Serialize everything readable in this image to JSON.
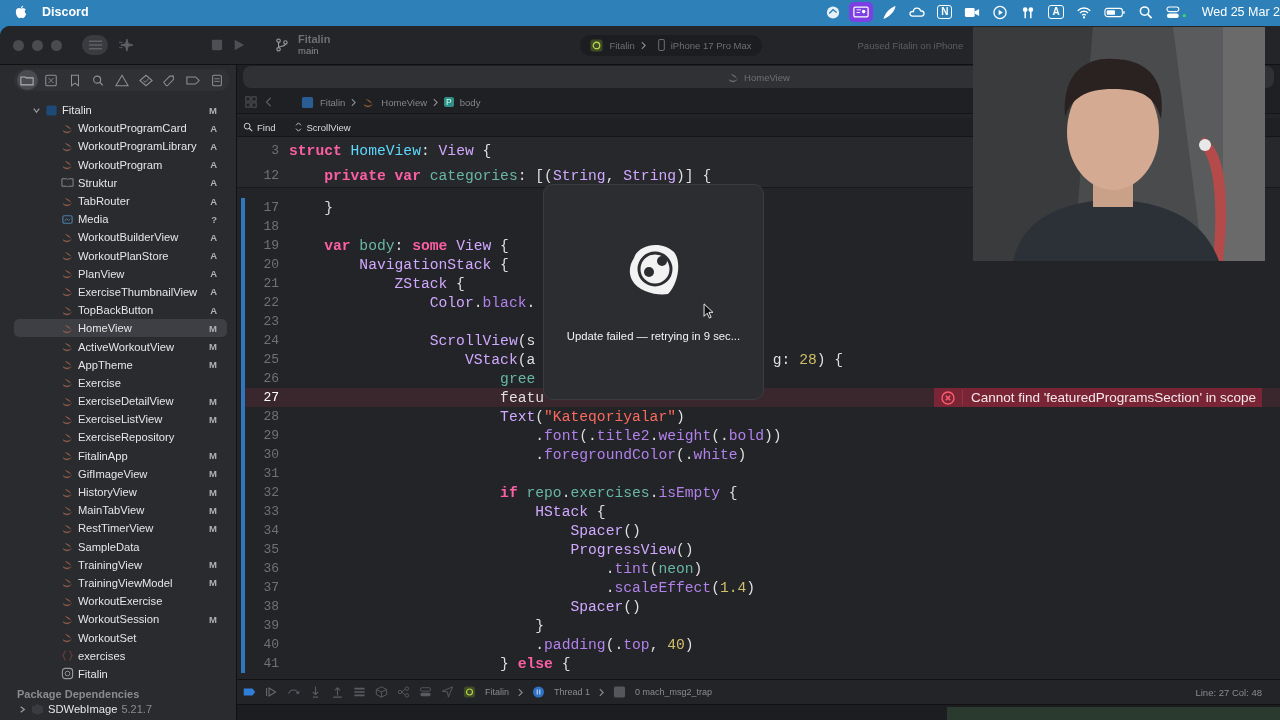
{
  "menu_bar": {
    "app_name": "Discord",
    "extras": [
      {
        "kind": "sync",
        "active": false
      },
      {
        "kind": "screen",
        "active": true
      },
      {
        "kind": "feather",
        "active": false
      },
      {
        "kind": "cloud",
        "active": false
      },
      {
        "kind": "letter",
        "glyph": "N",
        "active": false
      },
      {
        "kind": "camera",
        "active": false
      },
      {
        "kind": "play",
        "active": false
      },
      {
        "kind": "earbuds",
        "active": false
      },
      {
        "kind": "letter",
        "glyph": "A",
        "active": false
      },
      {
        "kind": "wifi",
        "active": false
      },
      {
        "kind": "battery",
        "active": false
      },
      {
        "kind": "search",
        "active": false
      },
      {
        "kind": "control",
        "active": false
      }
    ],
    "clock": "Wed 25 Mar 2"
  },
  "toolbar": {
    "project": "Fitalin",
    "branch": "main",
    "scheme": "Fitalin",
    "destination": "iPhone 17 Pro Max",
    "status": "Paused Fitalin on iPhone"
  },
  "navigator_tabs": [
    {
      "selected": true
    },
    {
      "selected": false
    },
    {
      "selected": false
    },
    {
      "selected": false
    },
    {
      "selected": false
    },
    {
      "selected": false
    },
    {
      "selected": false
    },
    {
      "selected": false
    },
    {
      "selected": false
    }
  ],
  "sidebar": {
    "project": {
      "name": "Fitalin",
      "status": "M",
      "kind": "project",
      "expanded": true,
      "selected": false,
      "children": [
        {
          "name": "WorkoutProgramCard",
          "status": "A",
          "kind": "swift",
          "selected": false
        },
        {
          "name": "WorkoutProgramLibrary",
          "status": "A",
          "kind": "swift",
          "selected": false
        },
        {
          "name": "WorkoutProgram",
          "status": "A",
          "kind": "swift",
          "selected": false
        },
        {
          "name": "Struktur",
          "status": "A",
          "kind": "book",
          "selected": false
        },
        {
          "name": "TabRouter",
          "status": "A",
          "kind": "swift",
          "selected": false
        },
        {
          "name": "Media",
          "status": "?",
          "kind": "assets",
          "selected": false
        },
        {
          "name": "WorkoutBuilderView",
          "status": "A",
          "kind": "swift",
          "selected": false
        },
        {
          "name": "WorkoutPlanStore",
          "status": "A",
          "kind": "swift",
          "selected": false
        },
        {
          "name": "PlanView",
          "status": "A",
          "kind": "swift",
          "selected": false
        },
        {
          "name": "ExerciseThumbnailView",
          "status": "A",
          "kind": "swift",
          "selected": false
        },
        {
          "name": "TopBackButton",
          "status": "A",
          "kind": "swift",
          "selected": false
        },
        {
          "name": "HomeView",
          "status": "M",
          "kind": "swift",
          "selected": true
        },
        {
          "name": "ActiveWorkoutView",
          "status": "M",
          "kind": "swift",
          "selected": false
        },
        {
          "name": "AppTheme",
          "status": "M",
          "kind": "swift",
          "selected": false
        },
        {
          "name": "Exercise",
          "kind": "swift",
          "selected": false
        },
        {
          "name": "ExerciseDetailView",
          "status": "M",
          "kind": "swift",
          "selected": false
        },
        {
          "name": "ExerciseListView",
          "status": "M",
          "kind": "swift",
          "selected": false
        },
        {
          "name": "ExerciseRepository",
          "kind": "swift",
          "selected": false
        },
        {
          "name": "FitalinApp",
          "status": "M",
          "kind": "swift",
          "selected": false
        },
        {
          "name": "GifImageView",
          "status": "M",
          "kind": "swift",
          "selected": false
        },
        {
          "name": "HistoryView",
          "status": "M",
          "kind": "swift",
          "selected": false
        },
        {
          "name": "MainTabView",
          "status": "M",
          "kind": "swift",
          "selected": false
        },
        {
          "name": "RestTimerView",
          "status": "M",
          "kind": "swift",
          "selected": false
        },
        {
          "name": "SampleData",
          "kind": "swift",
          "selected": false
        },
        {
          "name": "TrainingView",
          "status": "M",
          "kind": "swift",
          "selected": false
        },
        {
          "name": "TrainingViewModel",
          "status": "M",
          "kind": "swift",
          "selected": false
        },
        {
          "name": "WorkoutExercise",
          "kind": "swift",
          "selected": false
        },
        {
          "name": "WorkoutSession",
          "status": "M",
          "kind": "swift",
          "selected": false
        },
        {
          "name": "WorkoutSet",
          "kind": "swift",
          "selected": false
        },
        {
          "name": "exercises",
          "kind": "json",
          "selected": false
        },
        {
          "name": "Fitalin",
          "kind": "app",
          "selected": false
        }
      ]
    },
    "packages": {
      "title": "Package Dependencies",
      "items": [
        {
          "name": "SDWebImage",
          "version": "5.21.7",
          "expanded": false
        }
      ]
    }
  },
  "editor": {
    "tab": "HomeView",
    "breadcrumb": {
      "project": "Fitalin",
      "file": "HomeView",
      "symbol_badge": "P",
      "symbol": "body"
    },
    "find": {
      "label": "Find",
      "scope": "ScrollView"
    },
    "sticky_lines": [
      {
        "number": "3",
        "tokens": [
          {
            "kind": "kw",
            "text": "struct"
          },
          {
            "kind": "decl",
            "text": " HomeView"
          },
          {
            "kind": "plain",
            "text": ": "
          },
          {
            "kind": "type",
            "text": "View"
          },
          {
            "kind": "plain",
            "text": " {"
          }
        ]
      },
      {
        "number": "12",
        "tokens": [
          {
            "kind": "kw",
            "text": "    private var"
          },
          {
            "kind": "var",
            "text": " categories"
          },
          {
            "kind": "plain",
            "text": ": [("
          },
          {
            "kind": "type",
            "text": "String"
          },
          {
            "kind": "plain",
            "text": ", "
          },
          {
            "kind": "type",
            "text": "String"
          },
          {
            "kind": "plain",
            "text": ")] {"
          }
        ]
      }
    ],
    "lines": [
      {
        "number": "17",
        "current": false,
        "tokens": [
          {
            "kind": "plain",
            "text": "    }"
          }
        ]
      },
      {
        "number": "18",
        "current": false
      },
      {
        "number": "19",
        "current": false,
        "tokens": [
          {
            "kind": "kw",
            "text": "    var"
          },
          {
            "kind": "var",
            "text": " body"
          },
          {
            "kind": "plain",
            "text": ": "
          },
          {
            "kind": "kw",
            "text": "some"
          },
          {
            "kind": "type",
            "text": " View"
          },
          {
            "kind": "plain",
            "text": " {"
          }
        ]
      },
      {
        "number": "20",
        "current": false,
        "tokens": [
          {
            "kind": "type",
            "text": "        NavigationStack"
          },
          {
            "kind": "plain",
            "text": " {"
          }
        ]
      },
      {
        "number": "21",
        "current": false,
        "tokens": [
          {
            "kind": "type",
            "text": "            ZStack"
          },
          {
            "kind": "plain",
            "text": " {"
          }
        ]
      },
      {
        "number": "22",
        "current": false,
        "tokens": [
          {
            "kind": "type",
            "text": "                Color"
          },
          {
            "kind": "plain",
            "text": "."
          },
          {
            "kind": "member",
            "text": "black"
          },
          {
            "kind": "plain",
            "text": "."
          }
        ]
      },
      {
        "number": "23",
        "current": false
      },
      {
        "number": "24",
        "current": false,
        "tokens": [
          {
            "kind": "type",
            "text": "                ScrollView"
          },
          {
            "kind": "plain",
            "text": "(s"
          }
        ]
      },
      {
        "number": "25",
        "current": false,
        "tokens": [
          {
            "kind": "type",
            "text": "                    VStack"
          },
          {
            "kind": "plain",
            "text": "(a                           g: "
          },
          {
            "kind": "num",
            "text": "28"
          },
          {
            "kind": "plain",
            "text": ") {"
          }
        ]
      },
      {
        "number": "26",
        "current": false,
        "tokens": [
          {
            "kind": "var",
            "text": "                        gree"
          }
        ]
      },
      {
        "number": "27",
        "current": true,
        "tokens": [
          {
            "kind": "plain",
            "text": "                        featu"
          }
        ],
        "error": "Cannot find 'featuredProgramsSection' in scope"
      },
      {
        "number": "28",
        "current": false,
        "tokens": [
          {
            "kind": "type",
            "text": "                        Text"
          },
          {
            "kind": "plain",
            "text": "("
          },
          {
            "kind": "str",
            "text": "\"Kateqoriyalar\""
          },
          {
            "kind": "plain",
            "text": ")"
          }
        ]
      },
      {
        "number": "29",
        "current": false,
        "tokens": [
          {
            "kind": "plain",
            "text": "                            ."
          },
          {
            "kind": "member",
            "text": "font"
          },
          {
            "kind": "plain",
            "text": "(."
          },
          {
            "kind": "member",
            "text": "title2"
          },
          {
            "kind": "plain",
            "text": "."
          },
          {
            "kind": "member",
            "text": "weight"
          },
          {
            "kind": "plain",
            "text": "(."
          },
          {
            "kind": "member",
            "text": "bold"
          },
          {
            "kind": "plain",
            "text": "))"
          }
        ]
      },
      {
        "number": "30",
        "current": false,
        "tokens": [
          {
            "kind": "plain",
            "text": "                            ."
          },
          {
            "kind": "member",
            "text": "foregroundColor"
          },
          {
            "kind": "plain",
            "text": "(."
          },
          {
            "kind": "member",
            "text": "white"
          },
          {
            "kind": "plain",
            "text": ")"
          }
        ]
      },
      {
        "number": "31",
        "current": false
      },
      {
        "number": "32",
        "current": false,
        "tokens": [
          {
            "kind": "kw",
            "text": "                        if"
          },
          {
            "kind": "var",
            "text": " repo"
          },
          {
            "kind": "plain",
            "text": "."
          },
          {
            "kind": "var",
            "text": "exercises"
          },
          {
            "kind": "plain",
            "text": "."
          },
          {
            "kind": "member",
            "text": "isEmpty"
          },
          {
            "kind": "plain",
            "text": " {"
          }
        ]
      },
      {
        "number": "33",
        "current": false,
        "tokens": [
          {
            "kind": "type",
            "text": "                            HStack"
          },
          {
            "kind": "plain",
            "text": " {"
          }
        ]
      },
      {
        "number": "34",
        "current": false,
        "tokens": [
          {
            "kind": "type",
            "text": "                                Spacer"
          },
          {
            "kind": "plain",
            "text": "()"
          }
        ]
      },
      {
        "number": "35",
        "current": false,
        "tokens": [
          {
            "kind": "type",
            "text": "                                ProgressView"
          },
          {
            "kind": "plain",
            "text": "()"
          }
        ]
      },
      {
        "number": "36",
        "current": false,
        "tokens": [
          {
            "kind": "plain",
            "text": "                                    ."
          },
          {
            "kind": "member",
            "text": "tint"
          },
          {
            "kind": "plain",
            "text": "("
          },
          {
            "kind": "var",
            "text": "neon"
          },
          {
            "kind": "plain",
            "text": ")"
          }
        ]
      },
      {
        "number": "37",
        "current": false,
        "tokens": [
          {
            "kind": "plain",
            "text": "                                    ."
          },
          {
            "kind": "member",
            "text": "scaleEffect"
          },
          {
            "kind": "plain",
            "text": "("
          },
          {
            "kind": "num",
            "text": "1.4"
          },
          {
            "kind": "plain",
            "text": ")"
          }
        ]
      },
      {
        "number": "38",
        "current": false,
        "tokens": [
          {
            "kind": "type",
            "text": "                                Spacer"
          },
          {
            "kind": "plain",
            "text": "()"
          }
        ]
      },
      {
        "number": "39",
        "current": false,
        "tokens": [
          {
            "kind": "plain",
            "text": "                            }"
          }
        ]
      },
      {
        "number": "40",
        "current": false,
        "tokens": [
          {
            "kind": "plain",
            "text": "                            ."
          },
          {
            "kind": "member",
            "text": "padding"
          },
          {
            "kind": "plain",
            "text": "(."
          },
          {
            "kind": "member",
            "text": "top"
          },
          {
            "kind": "plain",
            "text": ", "
          },
          {
            "kind": "num",
            "text": "40"
          },
          {
            "kind": "plain",
            "text": ")"
          }
        ]
      },
      {
        "number": "41",
        "current": false,
        "tokens": [
          {
            "kind": "plain",
            "text": "                        } "
          },
          {
            "kind": "kw",
            "text": "else"
          },
          {
            "kind": "plain",
            "text": " {"
          }
        ]
      }
    ]
  },
  "debug_bar": {
    "target": "Fitalin",
    "thread": "Thread 1",
    "frame": "0 mach_msg2_trap",
    "position": "Line: 27  Col: 48"
  },
  "update_popup": {
    "message": "Update failed — retrying in 9 sec..."
  }
}
